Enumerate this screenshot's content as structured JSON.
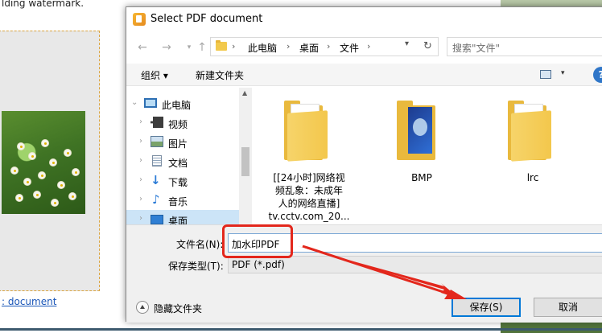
{
  "background": {
    "top_text": "lding watermark.",
    "link_text": ": document"
  },
  "dialog": {
    "title": "Select PDF document",
    "address": {
      "segments": [
        "此电脑",
        "桌面",
        "文件"
      ],
      "separator": "›"
    },
    "search": {
      "placeholder": "搜索\"文件\""
    },
    "toolbar": {
      "organize": "组织 ▾",
      "new_folder": "新建文件夹",
      "help": "?"
    },
    "nav": {
      "items": [
        {
          "label": "此电脑",
          "icon": "computer-icon"
        },
        {
          "label": "视频",
          "icon": "video-icon"
        },
        {
          "label": "图片",
          "icon": "picture-icon"
        },
        {
          "label": "文档",
          "icon": "document-icon"
        },
        {
          "label": "下载",
          "icon": "download-icon"
        },
        {
          "label": "音乐",
          "icon": "music-icon"
        },
        {
          "label": "桌面",
          "icon": "desktop-icon"
        }
      ]
    },
    "files": [
      {
        "label_lines": [
          "[[24小时]网络视",
          "频乱象：未成年",
          "人的网络直播]",
          "tv.cctv.com_20..."
        ]
      },
      {
        "label_lines": [
          "BMP"
        ]
      },
      {
        "label_lines": [
          "lrc"
        ]
      }
    ],
    "filename": {
      "label": "文件名(N):",
      "value": "加水印PDF"
    },
    "filetype": {
      "label": "保存类型(T):",
      "value": "PDF (*.pdf)"
    },
    "hide_folders": "隐藏文件夹",
    "save_button": "保存(S)",
    "cancel_button": "取消"
  },
  "colors": {
    "annotation_red": "#e3271c",
    "primary_border": "#0078d7",
    "selected_nav": "#cce4f7"
  }
}
